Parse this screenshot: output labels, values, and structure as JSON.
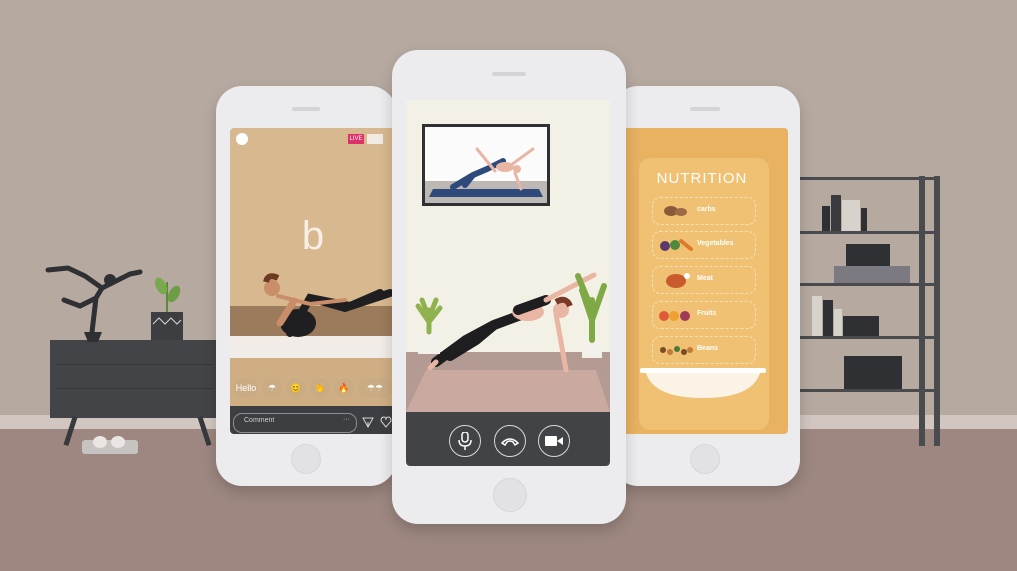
{
  "left_phone": {
    "live_badge": "LIVE",
    "brand_letter": "b",
    "chips": [
      "Hello",
      "☂",
      "😊",
      "👏",
      "🔥",
      "☂☂"
    ],
    "comment_placeholder": "Comment",
    "more": "···"
  },
  "center_phone": {
    "call_buttons": [
      "microphone-icon",
      "hang-up-icon",
      "video-camera-icon"
    ]
  },
  "right_phone": {
    "title": "NUTRITION",
    "items": [
      "carbs",
      "Vegetables",
      "Meat",
      "Fruits",
      "Beans"
    ]
  },
  "colors": {
    "wall": "#b6a9a0",
    "floor": "#9d8780",
    "nutrition_bg": "#e8b261",
    "live_badge": "#e0306a",
    "call_bar": "#424347"
  }
}
